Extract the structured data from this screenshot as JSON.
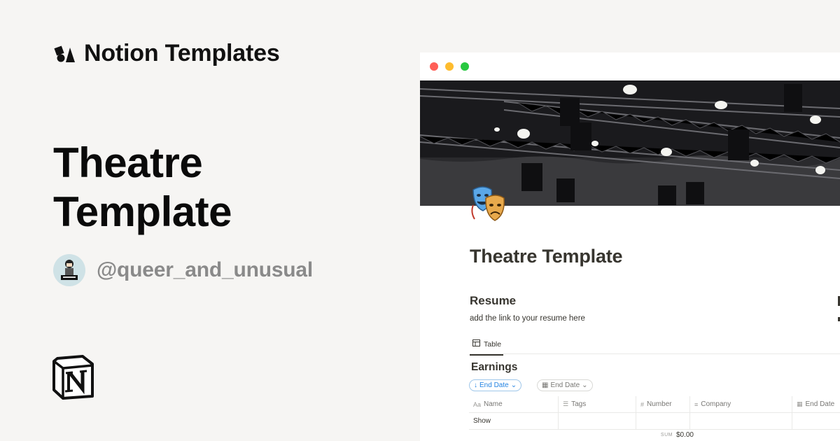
{
  "brand": {
    "name": "Notion Templates"
  },
  "headline": {
    "line1": "Theatre",
    "line2": "Template"
  },
  "author": {
    "handle": "@queer_and_unusual",
    "avatar_caption": "?€#+"
  },
  "window": {
    "page_title": "Theatre Template",
    "resume_heading": "Resume",
    "resume_text": "add the link to your resume here",
    "view_tab": "Table",
    "database_title": "Earnings",
    "sort_pill": "End Date",
    "filter_pill": "End Date",
    "columns": [
      {
        "icon": "Aa",
        "label": "Name"
      },
      {
        "icon": "☰",
        "label": "Tags"
      },
      {
        "icon": "#",
        "label": "Number"
      },
      {
        "icon": "≡",
        "label": "Company"
      },
      {
        "icon": "▦",
        "label": "End Date"
      }
    ],
    "rows": [
      {
        "name": "Show",
        "tags": "",
        "number": "",
        "company": "",
        "end_date": ""
      }
    ],
    "sum_label": "SUM",
    "sum_value": "$0.00"
  },
  "colors": {
    "background": "#f6f5f3",
    "accent_blue": "#2383e2",
    "text_dark": "#37352f",
    "handle_gray": "#8a8a8a"
  }
}
